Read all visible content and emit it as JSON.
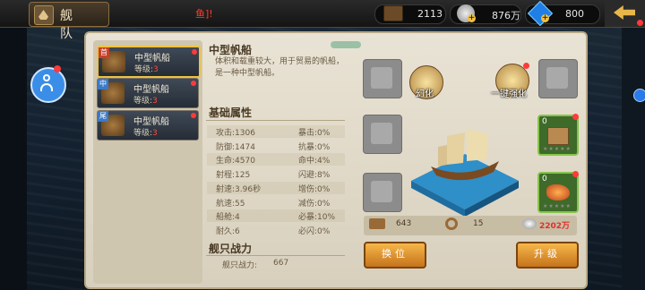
{
  "topbar": {
    "title": "舰 队",
    "message": "鱼]!",
    "resources": [
      {
        "icon": "chest-icon",
        "value": "2113"
      },
      {
        "icon": "silver-coin-icon",
        "value": "876万"
      },
      {
        "icon": "diamond-icon",
        "value": "800"
      }
    ]
  },
  "ships": [
    {
      "badge": "首",
      "name": "中型帆船",
      "level_label": "等级:",
      "level": "3",
      "selected": true
    },
    {
      "badge": "中",
      "name": "中型帆船",
      "level_label": "等级:",
      "level": "3",
      "selected": false
    },
    {
      "badge": "尾",
      "name": "中型帆船",
      "level_label": "等级:",
      "level": "3",
      "selected": false
    }
  ],
  "detail": {
    "name": "中型帆船",
    "description": "体积和载重较大，用于贸易的帆船，是一种中型帆船。",
    "base_title": "基础属性",
    "stats_left": [
      {
        "label": "攻击",
        "value": "1306"
      },
      {
        "label": "防御",
        "value": "1474"
      },
      {
        "label": "生命",
        "value": "4570"
      },
      {
        "label": "射程",
        "value": "125"
      },
      {
        "label": "射速",
        "value": "3.96秒"
      },
      {
        "label": "航速",
        "value": "55"
      },
      {
        "label": "船舱",
        "value": "4"
      },
      {
        "label": "耐久",
        "value": "6"
      }
    ],
    "stats_right": [
      {
        "label": "暴击",
        "value": "0%"
      },
      {
        "label": "抗暴",
        "value": "0%"
      },
      {
        "label": "命中",
        "value": "4%"
      },
      {
        "label": "闪避",
        "value": "8%"
      },
      {
        "label": "增伤",
        "value": "0%"
      },
      {
        "label": "减伤",
        "value": "0%"
      },
      {
        "label": "必暴",
        "value": "10%"
      },
      {
        "label": "必闪",
        "value": "0%"
      }
    ],
    "power_title": "舰只战力",
    "power_label": "舰只战力:",
    "power_value": "667"
  },
  "actions": {
    "transform": "幻化",
    "auto_equip": "一键强化",
    "swap": "换位",
    "upgrade": "升级"
  },
  "equip_slots": [
    {
      "count": "0",
      "kind": "crate"
    },
    {
      "count": "0",
      "kind": "dragon"
    }
  ],
  "costs": [
    {
      "icon": "wood-icon",
      "value": "643"
    },
    {
      "icon": "rope-icon",
      "value": "15"
    },
    {
      "icon": "silver-icon",
      "value": "2202万"
    }
  ],
  "colors": {
    "accent": "#f0c240",
    "danger": "#ff3a3a",
    "button": "#e39a33"
  }
}
